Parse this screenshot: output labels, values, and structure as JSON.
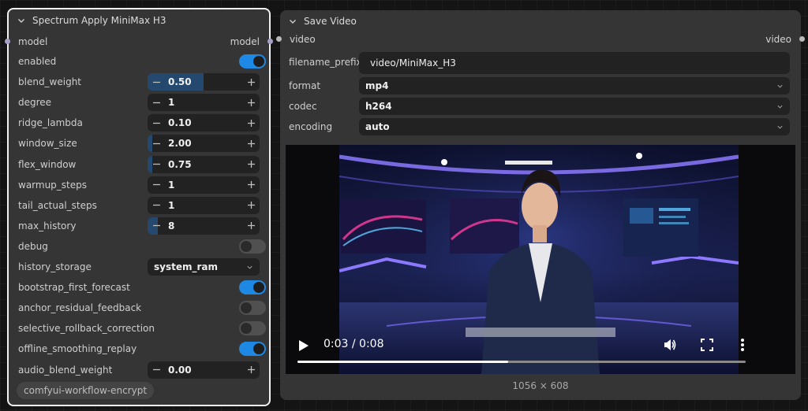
{
  "spectrum_node": {
    "title": "Spectrum Apply MiniMax H3",
    "input_label": "model",
    "output_label": "model",
    "widgets": [
      {
        "label": "enabled",
        "kind": "toggle",
        "on": true
      },
      {
        "label": "blend_weight",
        "kind": "number",
        "value": "0.50",
        "fill": 0.5
      },
      {
        "label": "degree",
        "kind": "number",
        "value": "1",
        "fill": 0
      },
      {
        "label": "ridge_lambda",
        "kind": "number",
        "value": "0.10",
        "fill": 0
      },
      {
        "label": "window_size",
        "kind": "number",
        "value": "2.00",
        "fill": 0.04
      },
      {
        "label": "flex_window",
        "kind": "number",
        "value": "0.75",
        "fill": 0.04
      },
      {
        "label": "warmup_steps",
        "kind": "number",
        "value": "1",
        "fill": 0
      },
      {
        "label": "tail_actual_steps",
        "kind": "number",
        "value": "1",
        "fill": 0
      },
      {
        "label": "max_history",
        "kind": "number",
        "value": "8",
        "fill": 0.09
      },
      {
        "label": "debug",
        "kind": "toggle",
        "on": false
      },
      {
        "label": "history_storage",
        "kind": "combo",
        "value": "system_ram"
      },
      {
        "label": "bootstrap_first_forecast",
        "kind": "toggle",
        "on": true
      },
      {
        "label": "anchor_residual_feedback",
        "kind": "toggle",
        "on": false
      },
      {
        "label": "selective_rollback_correction",
        "kind": "toggle",
        "on": false
      },
      {
        "label": "offline_smoothing_replay",
        "kind": "toggle",
        "on": true
      },
      {
        "label": "audio_blend_weight",
        "kind": "number",
        "value": "0.00",
        "fill": 0
      }
    ],
    "badge": "comfyui-workflow-encrypt"
  },
  "save_node": {
    "title": "Save Video",
    "input_label": "video",
    "output_label": "video",
    "filename_prefix": {
      "label": "filename_prefix",
      "value": "video/MiniMax_H3"
    },
    "format": {
      "label": "format",
      "value": "mp4"
    },
    "codec": {
      "label": "codec",
      "value": "h264"
    },
    "encoding": {
      "label": "encoding",
      "value": "auto"
    },
    "player": {
      "time": "0:03 / 0:08",
      "progress": 0.47
    },
    "dimensions": "1056 × 608"
  },
  "icons": {
    "collapse": "chevron-down-icon",
    "number_decrement": "minus-icon",
    "number_increment": "plus-icon",
    "combo": "chevron-down-icon",
    "play": "play-icon",
    "volume": "volume-icon",
    "fullscreen": "fullscreen-icon",
    "more": "more-vertical-icon"
  },
  "colors": {
    "toggle_on": "#1e88e5",
    "toggle_off": "#505050",
    "number_fill": "#25496e",
    "node_bg": "#353535",
    "selection_border": "#f2f2f2",
    "model_slot": "#a6a0c6"
  }
}
